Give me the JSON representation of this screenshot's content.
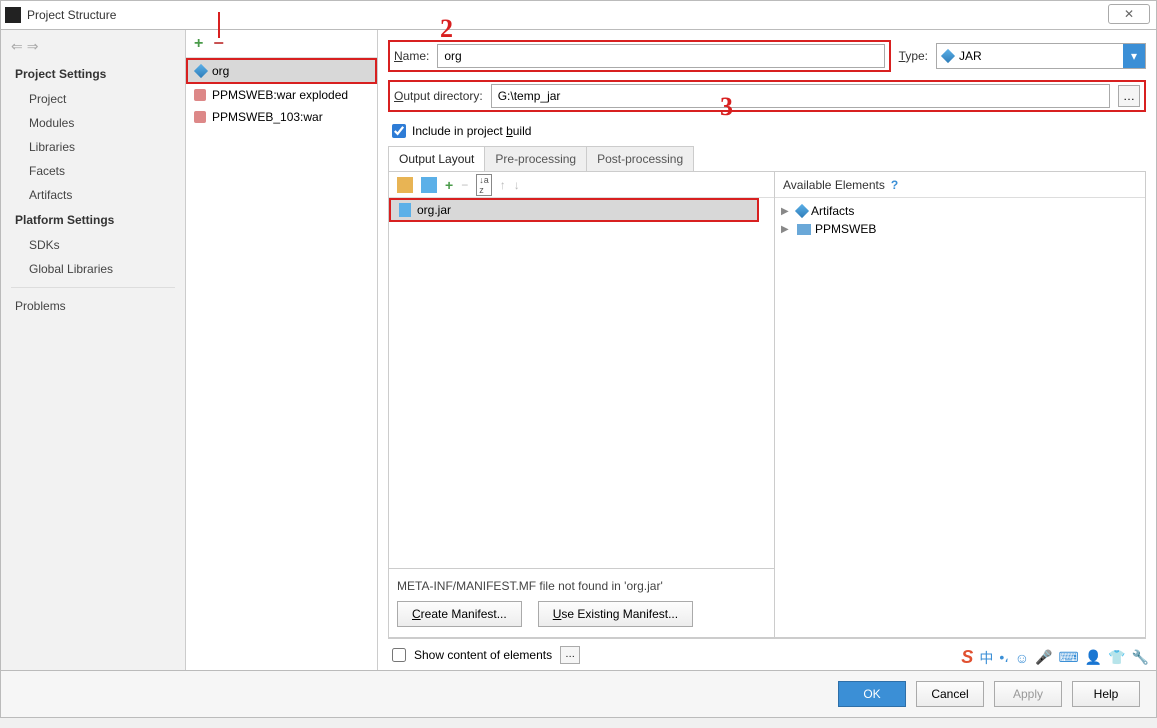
{
  "window": {
    "title": "Project Structure",
    "close_glyph": "✕"
  },
  "sidebar": {
    "headings": {
      "project": "Project Settings",
      "platform": "Platform Settings"
    },
    "project_items": [
      "Project",
      "Modules",
      "Libraries",
      "Facets",
      "Artifacts"
    ],
    "platform_items": [
      "SDKs",
      "Global Libraries"
    ],
    "problems": "Problems"
  },
  "artifacts_list": {
    "items": [
      {
        "label": "org",
        "icon": "diamond",
        "selected": true
      },
      {
        "label": "PPMSWEB:war exploded",
        "icon": "war",
        "selected": false
      },
      {
        "label": "PPMSWEB_103:war",
        "icon": "war",
        "selected": false
      }
    ]
  },
  "detail": {
    "name_label": "Name:",
    "name_value": "org",
    "type_label": "Type:",
    "type_value": "JAR",
    "output_label": "Output directory:",
    "output_value": "G:\\temp_jar",
    "include_label": "Include in project build",
    "include_checked": true,
    "tabs": [
      "Output Layout",
      "Pre-processing",
      "Post-processing"
    ],
    "layout_tree_item": "org.jar",
    "manifest_msg": "META-INF/MANIFEST.MF file not found in 'org.jar'",
    "create_manifest": "Create Manifest...",
    "use_manifest": "Use Existing Manifest...",
    "available_heading": "Available Elements",
    "available_items": [
      {
        "label": "Artifacts",
        "icon": "diamond"
      },
      {
        "label": "PPMSWEB",
        "icon": "folder"
      }
    ],
    "show_content": "Show content of elements"
  },
  "footer": {
    "ok": "OK",
    "cancel": "Cancel",
    "apply": "Apply",
    "help": "Help"
  },
  "annotations": {
    "n2": "2",
    "n3": "3"
  }
}
